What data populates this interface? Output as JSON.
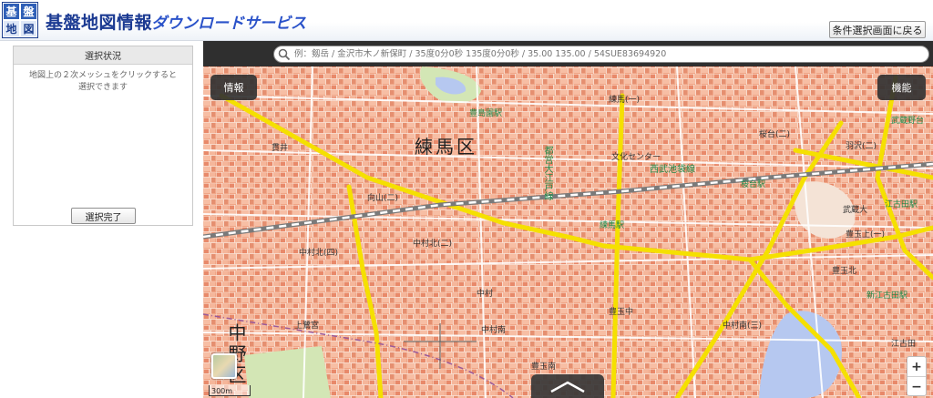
{
  "header": {
    "logo": [
      "基",
      "盤",
      "地",
      "図",
      "情",
      "報"
    ],
    "app_title": "基盤地図情報",
    "service_title": "ダウンロードサービス",
    "back_button": "条件選択画面に戻る"
  },
  "left_panel": {
    "title": "選択状況",
    "instructions": "地図上の２次メッシュをクリックすると\n選択できます",
    "finish_button": "選択完了"
  },
  "map": {
    "search_placeholder": "例：剱岳 / 金沢市木ノ新保町 / 35度0分0秒 135度0分0秒 / 35.00 135.00 / 54SUE83694920",
    "info_button": "情報",
    "function_button": "機能",
    "scale_label": "300m",
    "zoom_in": "+",
    "zoom_out": "−",
    "labels": {
      "ward_nerima": "練馬区",
      "ward_nakano": "中野区",
      "station_toshimaen": "豊島園駅",
      "station_nerima": "練馬駅",
      "station_sakuradai": "桜台駅",
      "station_ekoda": "江古田駅",
      "station_shin_egota": "新江古田駅",
      "station_musashidai": "武蔵野台",
      "line_seibu": "西武池袋線",
      "line_oedo": "都営大江戸線",
      "culture_center": "文化センター",
      "university": "武蔵大",
      "nakamura_kita_2": "中村北(二)",
      "nakamura": "中村",
      "nakamura_kita_4": "中村北(四)",
      "kanmura": "中村南",
      "toyotama_naka": "豊玉中",
      "toyotama_kita": "豊玉北",
      "toyotama_kami": "豊玉上(一)",
      "toyotama_minami": "豊玉南",
      "nerima_1": "練馬(一)",
      "mukaiyama": "向山(二)",
      "sakuradai": "桜台(二)",
      "hikawadai": "羽沢(二)",
      "ekoda": "江古田",
      "kami_takada": "上鷺宮",
      "nukui": "貫井",
      "shiba": "中村南(三)"
    }
  },
  "colors": {
    "brand_blue": "#1b3a92",
    "service_blue": "#2a52c9",
    "map_base": "#f2a98a",
    "main_road": "#f5e000",
    "railway": "#7a7a7a",
    "water": "#b6c8f0",
    "park": "#d3e6b5"
  }
}
